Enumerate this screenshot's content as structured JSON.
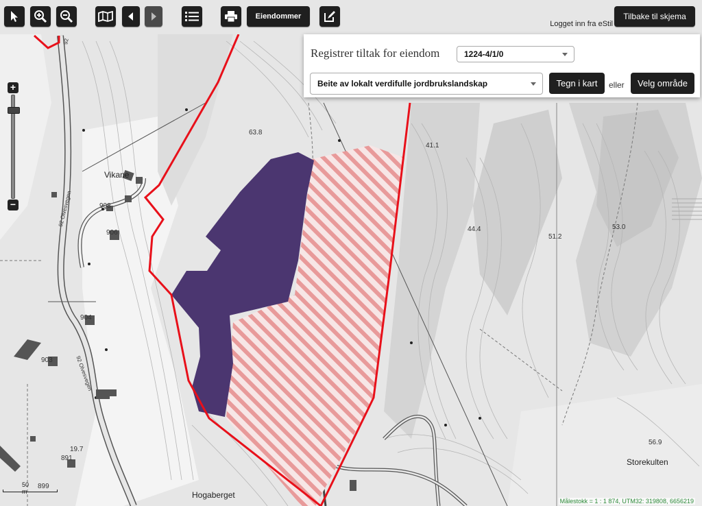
{
  "toolbar": {
    "buttons": [
      "select-pointer",
      "zoom-in",
      "zoom-out",
      "map-layers",
      "previous",
      "next",
      "list",
      "print"
    ],
    "eiendommer_label": "Eiendommer",
    "logged_in_text": "Logget inn fra eStil",
    "back_label": "Tilbake til skjema"
  },
  "panel": {
    "title": "Registrer tiltak for eiendom",
    "property_value": "1224-4/1/0",
    "measure_value": "Beite av lokalt verdifulle jordbrukslandskap",
    "draw_button": "Tegn i kart",
    "or_text": "eller",
    "select_area_button": "Velg område"
  },
  "map": {
    "labels": {
      "vikane": "Vikane",
      "hogaberget": "Hogaberget",
      "storekulten": "Storekulten",
      "h638": "63.8",
      "h411": "41.1",
      "h444": "44.4",
      "h512": "51.2",
      "h530": "53.0",
      "h569": "56.9",
      "n908": "908",
      "n906": "906",
      "n904": "904",
      "n903": "903",
      "n891": "891",
      "n197": "19.7",
      "n899": "899",
      "road1": "92 Olvesvegen",
      "road2": "92 Olvesvegen",
      "road3": "92 Olvesvegen",
      "road4": "92"
    },
    "scale_text": "50 m",
    "status_text": "Målestokk = 1 : 1 874, UTM32: 319808, 6656219"
  },
  "colors": {
    "property_outline": "#e8101a",
    "selected_area": "#4b3670",
    "hatch": "#e89a9a",
    "toolbar_button": "#1f1f1f"
  }
}
